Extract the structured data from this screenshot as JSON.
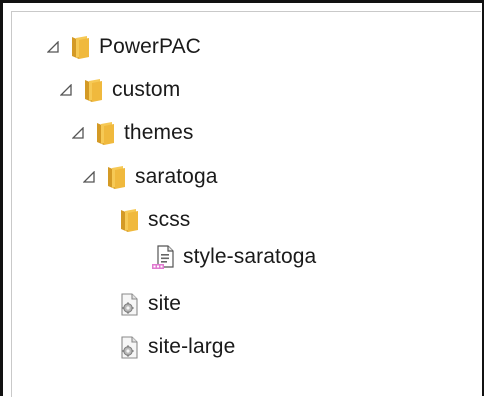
{
  "tree": {
    "items": [
      {
        "label": "PowerPAC",
        "type": "folder",
        "expanded": true,
        "icon": "folder-icon"
      },
      {
        "label": "custom",
        "type": "folder",
        "expanded": true,
        "icon": "folder-icon"
      },
      {
        "label": "themes",
        "type": "folder",
        "expanded": true,
        "icon": "folder-icon"
      },
      {
        "label": "saratoga",
        "type": "folder",
        "expanded": true,
        "icon": "folder-icon"
      },
      {
        "label": "scss",
        "type": "folder",
        "expanded": false,
        "icon": "folder-icon"
      },
      {
        "label": "style-saratoga",
        "type": "file",
        "icon": "scss-file-icon"
      },
      {
        "label": "site",
        "type": "file",
        "icon": "config-file-icon"
      },
      {
        "label": "site-large",
        "type": "file",
        "icon": "config-file-icon"
      }
    ]
  },
  "colors": {
    "folder_back": "#d9a22c",
    "folder_front": "#f5c64e",
    "expander": "#555555"
  }
}
